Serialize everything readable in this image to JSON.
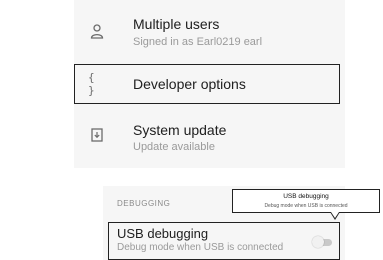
{
  "settings": {
    "items": [
      {
        "icon": "person-icon",
        "title": "Multiple users",
        "subtitle": "Signed in as Earl0219 earl"
      },
      {
        "icon": "braces-icon",
        "icon_text": "{ }",
        "title": "Developer options"
      },
      {
        "icon": "system-update-icon",
        "title": "System update",
        "subtitle": "Update available"
      }
    ]
  },
  "debugging": {
    "header": "DEBUGGING",
    "usb": {
      "title": "USB debugging",
      "subtitle": "Debug mode when USB is connected",
      "enabled": false
    }
  },
  "tooltip": {
    "title": "USB debugging",
    "subtitle": "Debug mode when USB is connected"
  },
  "colors": {
    "panel_bg": "#f6f6f6",
    "highlight_border": "#222222",
    "title_text": "#202020",
    "subtitle_text": "#9a9a9a"
  }
}
